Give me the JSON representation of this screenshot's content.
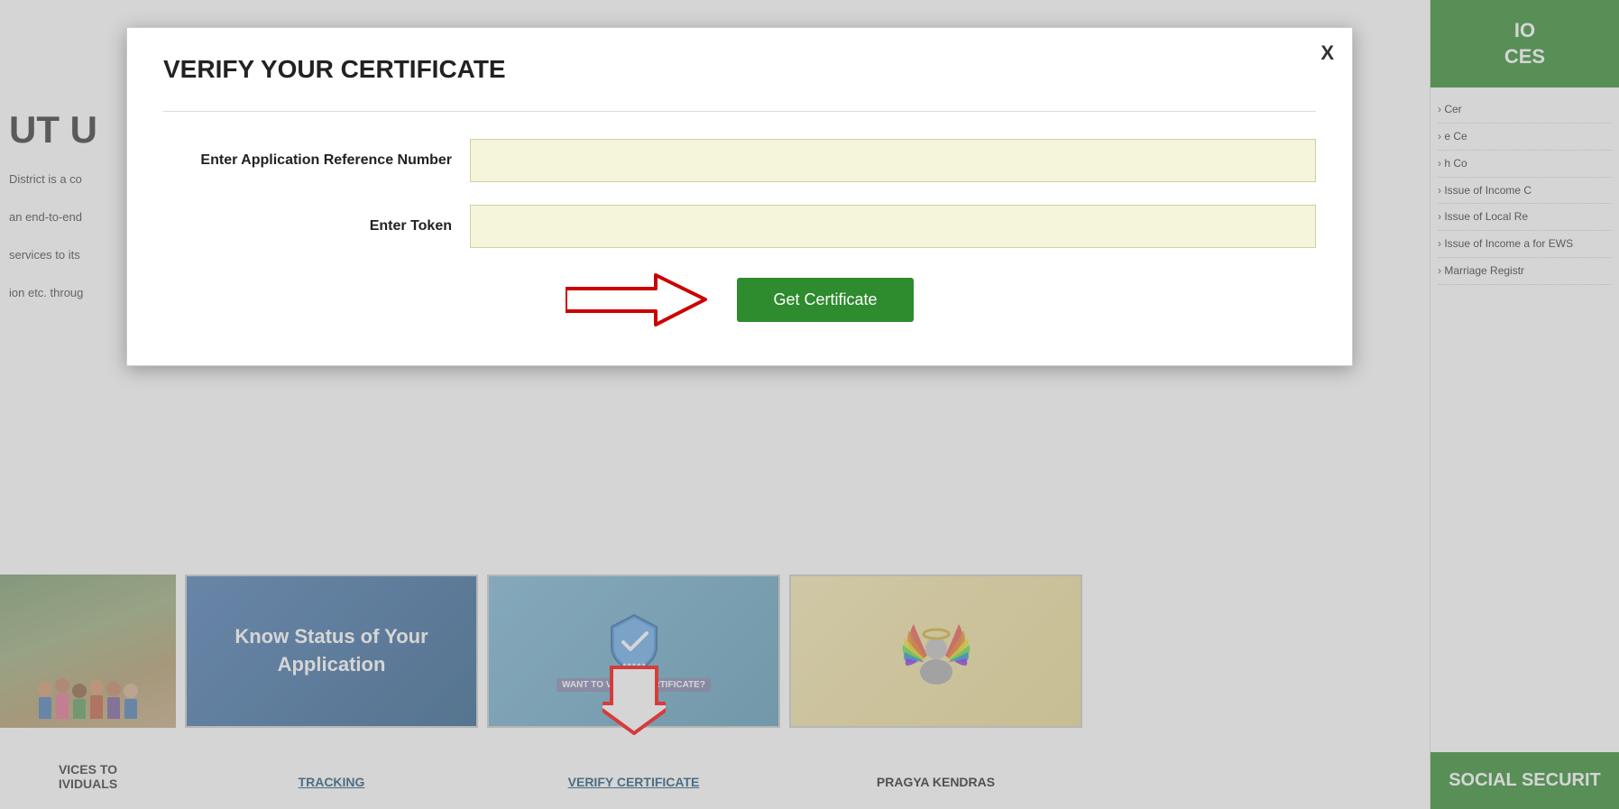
{
  "modal": {
    "title": "VERIFY YOUR CERTIFICATE",
    "close_label": "X",
    "fields": [
      {
        "id": "app-ref",
        "label": "Enter Application Reference Number",
        "placeholder": "",
        "value": ""
      },
      {
        "id": "token",
        "label": "Enter Token",
        "placeholder": "",
        "value": ""
      }
    ],
    "button_label": "Get Certificate"
  },
  "background": {
    "left_heading": "UT U",
    "left_texts": [
      "District is a co",
      "an end-to-end",
      "services to its",
      "ion etc. throug"
    ]
  },
  "sidebar": {
    "top_banner_line1": "IO",
    "top_banner_line2": "CES",
    "links": [
      "Cer",
      "e Ce",
      "h Co",
      "Issue of Income C",
      "Issue of Local Re",
      "Issue of Income a for EWS",
      "Marriage Registr"
    ],
    "bottom_banner": "SOCIAL SECURIT"
  },
  "cards": [
    {
      "id": "tracking",
      "title": "Know Status of Your Application",
      "label": "TRACKING"
    },
    {
      "id": "verify",
      "title": "WANT TO VERIFY CERTIFICATE?",
      "label": "VERIFY CERTIFICATE"
    },
    {
      "id": "pragya",
      "title": "",
      "label": "PRAGYA KENDRAS"
    }
  ],
  "services_section": {
    "line1": "VICES TO",
    "line2": "IVIDUALS"
  }
}
